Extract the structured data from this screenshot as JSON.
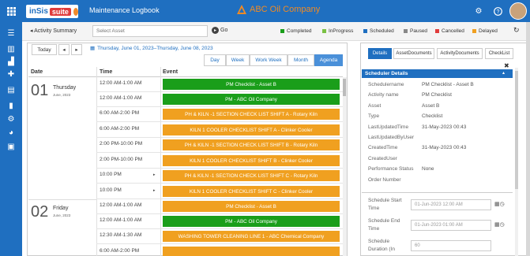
{
  "topbar": {
    "logo_text": "inSis",
    "logo_suite": "suite",
    "title": "Maintenance Logbook",
    "company": "ABC Oil Company",
    "icons": [
      "gear-icon",
      "help-icon",
      "user-avatar"
    ]
  },
  "sidebar": {
    "icons": [
      "menu-icon",
      "bank-icon",
      "chart-icon",
      "plus-icon",
      "table-icon",
      "document-icon",
      "settings-icon",
      "globe-icon",
      "file-icon"
    ]
  },
  "toolbar": {
    "summary_label": "Activity Summary",
    "asset_placeholder": "Select Asset",
    "go_label": "Go",
    "legend": [
      {
        "label": "Completed",
        "color": "#1a9e1a"
      },
      {
        "label": "InProgress",
        "color": "#7ac143"
      },
      {
        "label": "Scheduled",
        "color": "#1f6fc0"
      },
      {
        "label": "Paused",
        "color": "#888888"
      },
      {
        "label": "Cancelled",
        "color": "#e03b3b"
      },
      {
        "label": "Delayed",
        "color": "#f0a020"
      }
    ]
  },
  "calendar": {
    "today_label": "Today",
    "prev_label": "◂",
    "next_label": "▸",
    "date_range": "Thursday, June 01, 2023–Thursday, June 08, 2023",
    "views": [
      "Day",
      "Week",
      "Work Week",
      "Month",
      "Agenda"
    ],
    "active_view": "Agenda",
    "col_date": "Date",
    "col_time": "Time",
    "col_event": "Event",
    "days": [
      {
        "num": "01",
        "name": "Thursday",
        "date": "June, 2023"
      },
      {
        "num": "02",
        "name": "Friday",
        "date": "June, 2023"
      }
    ],
    "rows": [
      {
        "time": "12:00 AM-1:00 AM",
        "event": "PM Checklist - Asset B",
        "color": "green",
        "arrow": ""
      },
      {
        "time": "12:00 AM-1:00 AM",
        "event": "PM - ABC Oil Company",
        "color": "green",
        "arrow": ""
      },
      {
        "time": "6:00 AM-2:00 PM",
        "event": "PH & KILN -1 SECTION CHECK LIST SHIFT A - Rotary Kiln",
        "color": "orange",
        "arrow": ""
      },
      {
        "time": "6:00 AM-2:00 PM",
        "event": "KILN 1 COOLER CHECKLIST SHIFT A - Clinker Cooler",
        "color": "orange",
        "arrow": ""
      },
      {
        "time": "2:00 PM-10:00 PM",
        "event": "PH & KILN -1 SECTION CHECK LIST SHIFT B - Rotary Kiln",
        "color": "orange",
        "arrow": ""
      },
      {
        "time": "2:00 PM-10:00 PM",
        "event": "KILN 1 COOLER CHECKLIST SHIFT B - Clinker Cooler",
        "color": "orange",
        "arrow": ""
      },
      {
        "time": "10:00 PM",
        "event": "PH & KILN -1 SECTION CHECK LIST SHIFT C - Rotary Kiln",
        "color": "orange",
        "arrow": "▸"
      },
      {
        "time": "10:00 PM",
        "event": "KILN 1 COOLER CHECKLIST SHIFT C - Clinker Cooler",
        "color": "orange",
        "arrow": "▸"
      },
      {
        "time": "12:00 AM-1:00 AM",
        "event": "PM Checklist - Asset B",
        "color": "orange",
        "arrow": ""
      },
      {
        "time": "12:00 AM-1:00 AM",
        "event": "PM - ABC Oil Company",
        "color": "green",
        "arrow": ""
      },
      {
        "time": "12:30 AM-1:30 AM",
        "event": "WASHING TOWER CLEANING LINE 1 - ABC Chemical Company",
        "color": "orange",
        "arrow": ""
      },
      {
        "time": "6:00 AM-2:00 PM",
        "event": "",
        "color": "orange",
        "arrow": ""
      }
    ]
  },
  "details": {
    "tabs": [
      "Details",
      "AssetDocuments",
      "ActivityDocuments",
      "CheckList"
    ],
    "active_tab": "Details",
    "section_title": "Scheduler Details",
    "fields": [
      {
        "label": "Schedulername",
        "value": "PM Checklist - Asset B"
      },
      {
        "label": "Activity name",
        "value": "PM Checklist"
      },
      {
        "label": "Asset",
        "value": "Asset B"
      },
      {
        "label": "Type",
        "value": "Checklist"
      },
      {
        "label": "LastUpdatedTime",
        "value": "31-May-2023 00:43"
      },
      {
        "label": "LastUpdatedByUser",
        "value": ""
      },
      {
        "label": "CreatedTime",
        "value": "31-May-2023 00:43"
      },
      {
        "label": "CreatedUser",
        "value": ""
      },
      {
        "label": "Performance Status",
        "value": "None"
      },
      {
        "label": "Order Number",
        "value": ""
      }
    ],
    "inputs": [
      {
        "label_1": "Schedule Start",
        "label_2": "Time",
        "value": "01-Jun-2023 12:00 AM"
      },
      {
        "label_1": "Schedule End",
        "label_2": "Time",
        "value": "01-Jun-2023 01:00 AM"
      },
      {
        "label_1": "Schedule",
        "label_2": "Duration (In",
        "value": "60"
      }
    ]
  }
}
